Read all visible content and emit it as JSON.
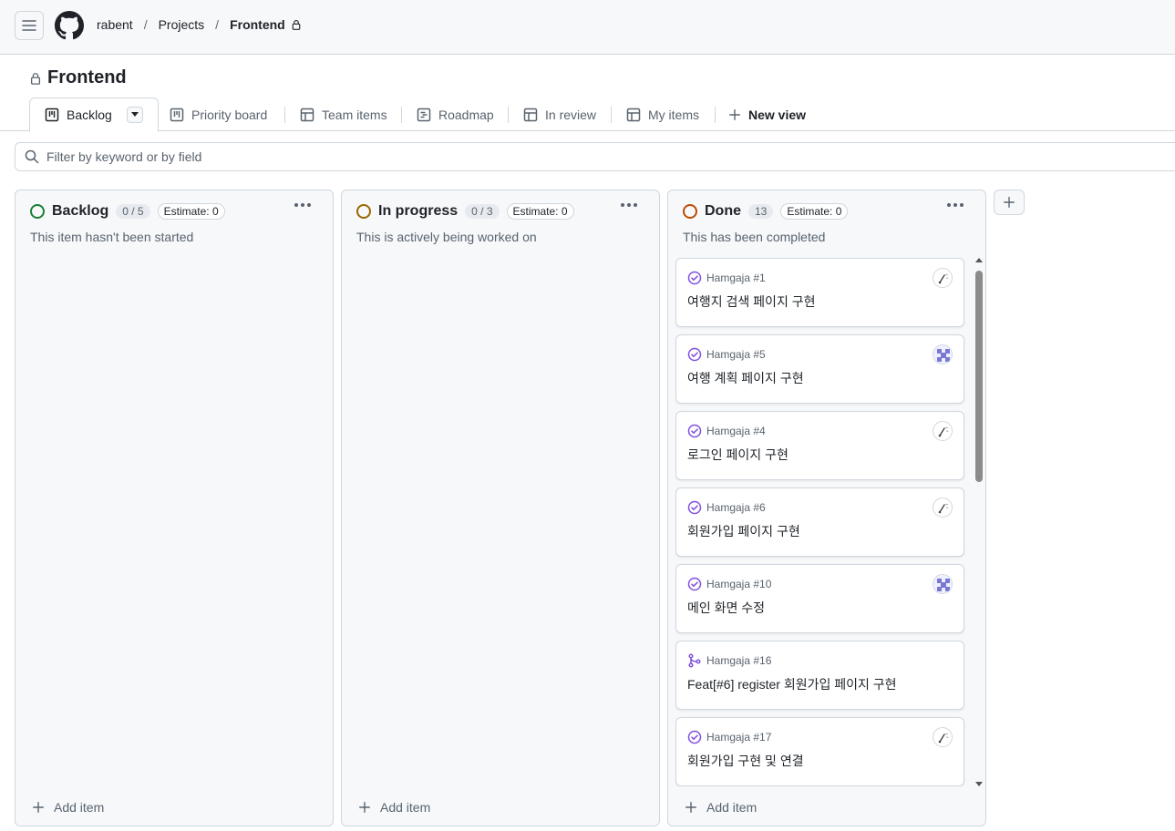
{
  "breadcrumb": {
    "owner": "rabent",
    "projects": "Projects",
    "project": "Frontend"
  },
  "project_title": "Frontend",
  "tabs": [
    {
      "label": "Backlog",
      "icon": "board-icon"
    },
    {
      "label": "Priority board",
      "icon": "board-icon"
    },
    {
      "label": "Team items",
      "icon": "table-icon"
    },
    {
      "label": "Roadmap",
      "icon": "roadmap-icon"
    },
    {
      "label": "In review",
      "icon": "table-icon"
    },
    {
      "label": "My items",
      "icon": "table-icon"
    },
    {
      "label": "New view",
      "icon": "plus-icon"
    }
  ],
  "filter": {
    "placeholder": "Filter by keyword or by field"
  },
  "columns": [
    {
      "name": "Backlog",
      "count": "0 / 5",
      "estimate": "Estimate: 0",
      "description": "This item hasn't been started",
      "status_color": "#1a7f37",
      "add_item": "Add item"
    },
    {
      "name": "In progress",
      "count": "0 / 3",
      "estimate": "Estimate: 0",
      "description": "This is actively being worked on",
      "status_color": "#9a6700",
      "add_item": "Add item"
    },
    {
      "name": "Done",
      "count": "13",
      "estimate": "Estimate: 0",
      "description": "This has been completed",
      "status_color": "#bc4c00",
      "add_item": "Add item"
    }
  ],
  "done_cards": [
    {
      "repo": "Hamgaja #1",
      "title": "여행지 검색 페이지 구현",
      "type": "issue-closed-icon",
      "avatar": "sketch-avatar"
    },
    {
      "repo": "Hamgaja #5",
      "title": "여행 계획 페이지 구현",
      "type": "issue-closed-icon",
      "avatar": "identicon-avatar"
    },
    {
      "repo": "Hamgaja #4",
      "title": "로그인 페이지 구현",
      "type": "issue-closed-icon",
      "avatar": "sketch-avatar"
    },
    {
      "repo": "Hamgaja #6",
      "title": "회원가입 페이지 구현",
      "type": "issue-closed-icon",
      "avatar": "sketch-avatar"
    },
    {
      "repo": "Hamgaja #10",
      "title": "메인 화면 수정",
      "type": "issue-closed-icon",
      "avatar": "identicon-avatar"
    },
    {
      "repo": "Hamgaja #16",
      "title": "Feat[#6] register 회원가입 페이지 구현",
      "type": "pull-request-merged-icon",
      "avatar": ""
    },
    {
      "repo": "Hamgaja #17",
      "title": "회원가입 구현 및 연결",
      "type": "issue-closed-icon",
      "avatar": "sketch-avatar"
    }
  ],
  "colors": {
    "done_purple": "#8250df",
    "border": "#d0d7de",
    "muted": "#59636e"
  }
}
